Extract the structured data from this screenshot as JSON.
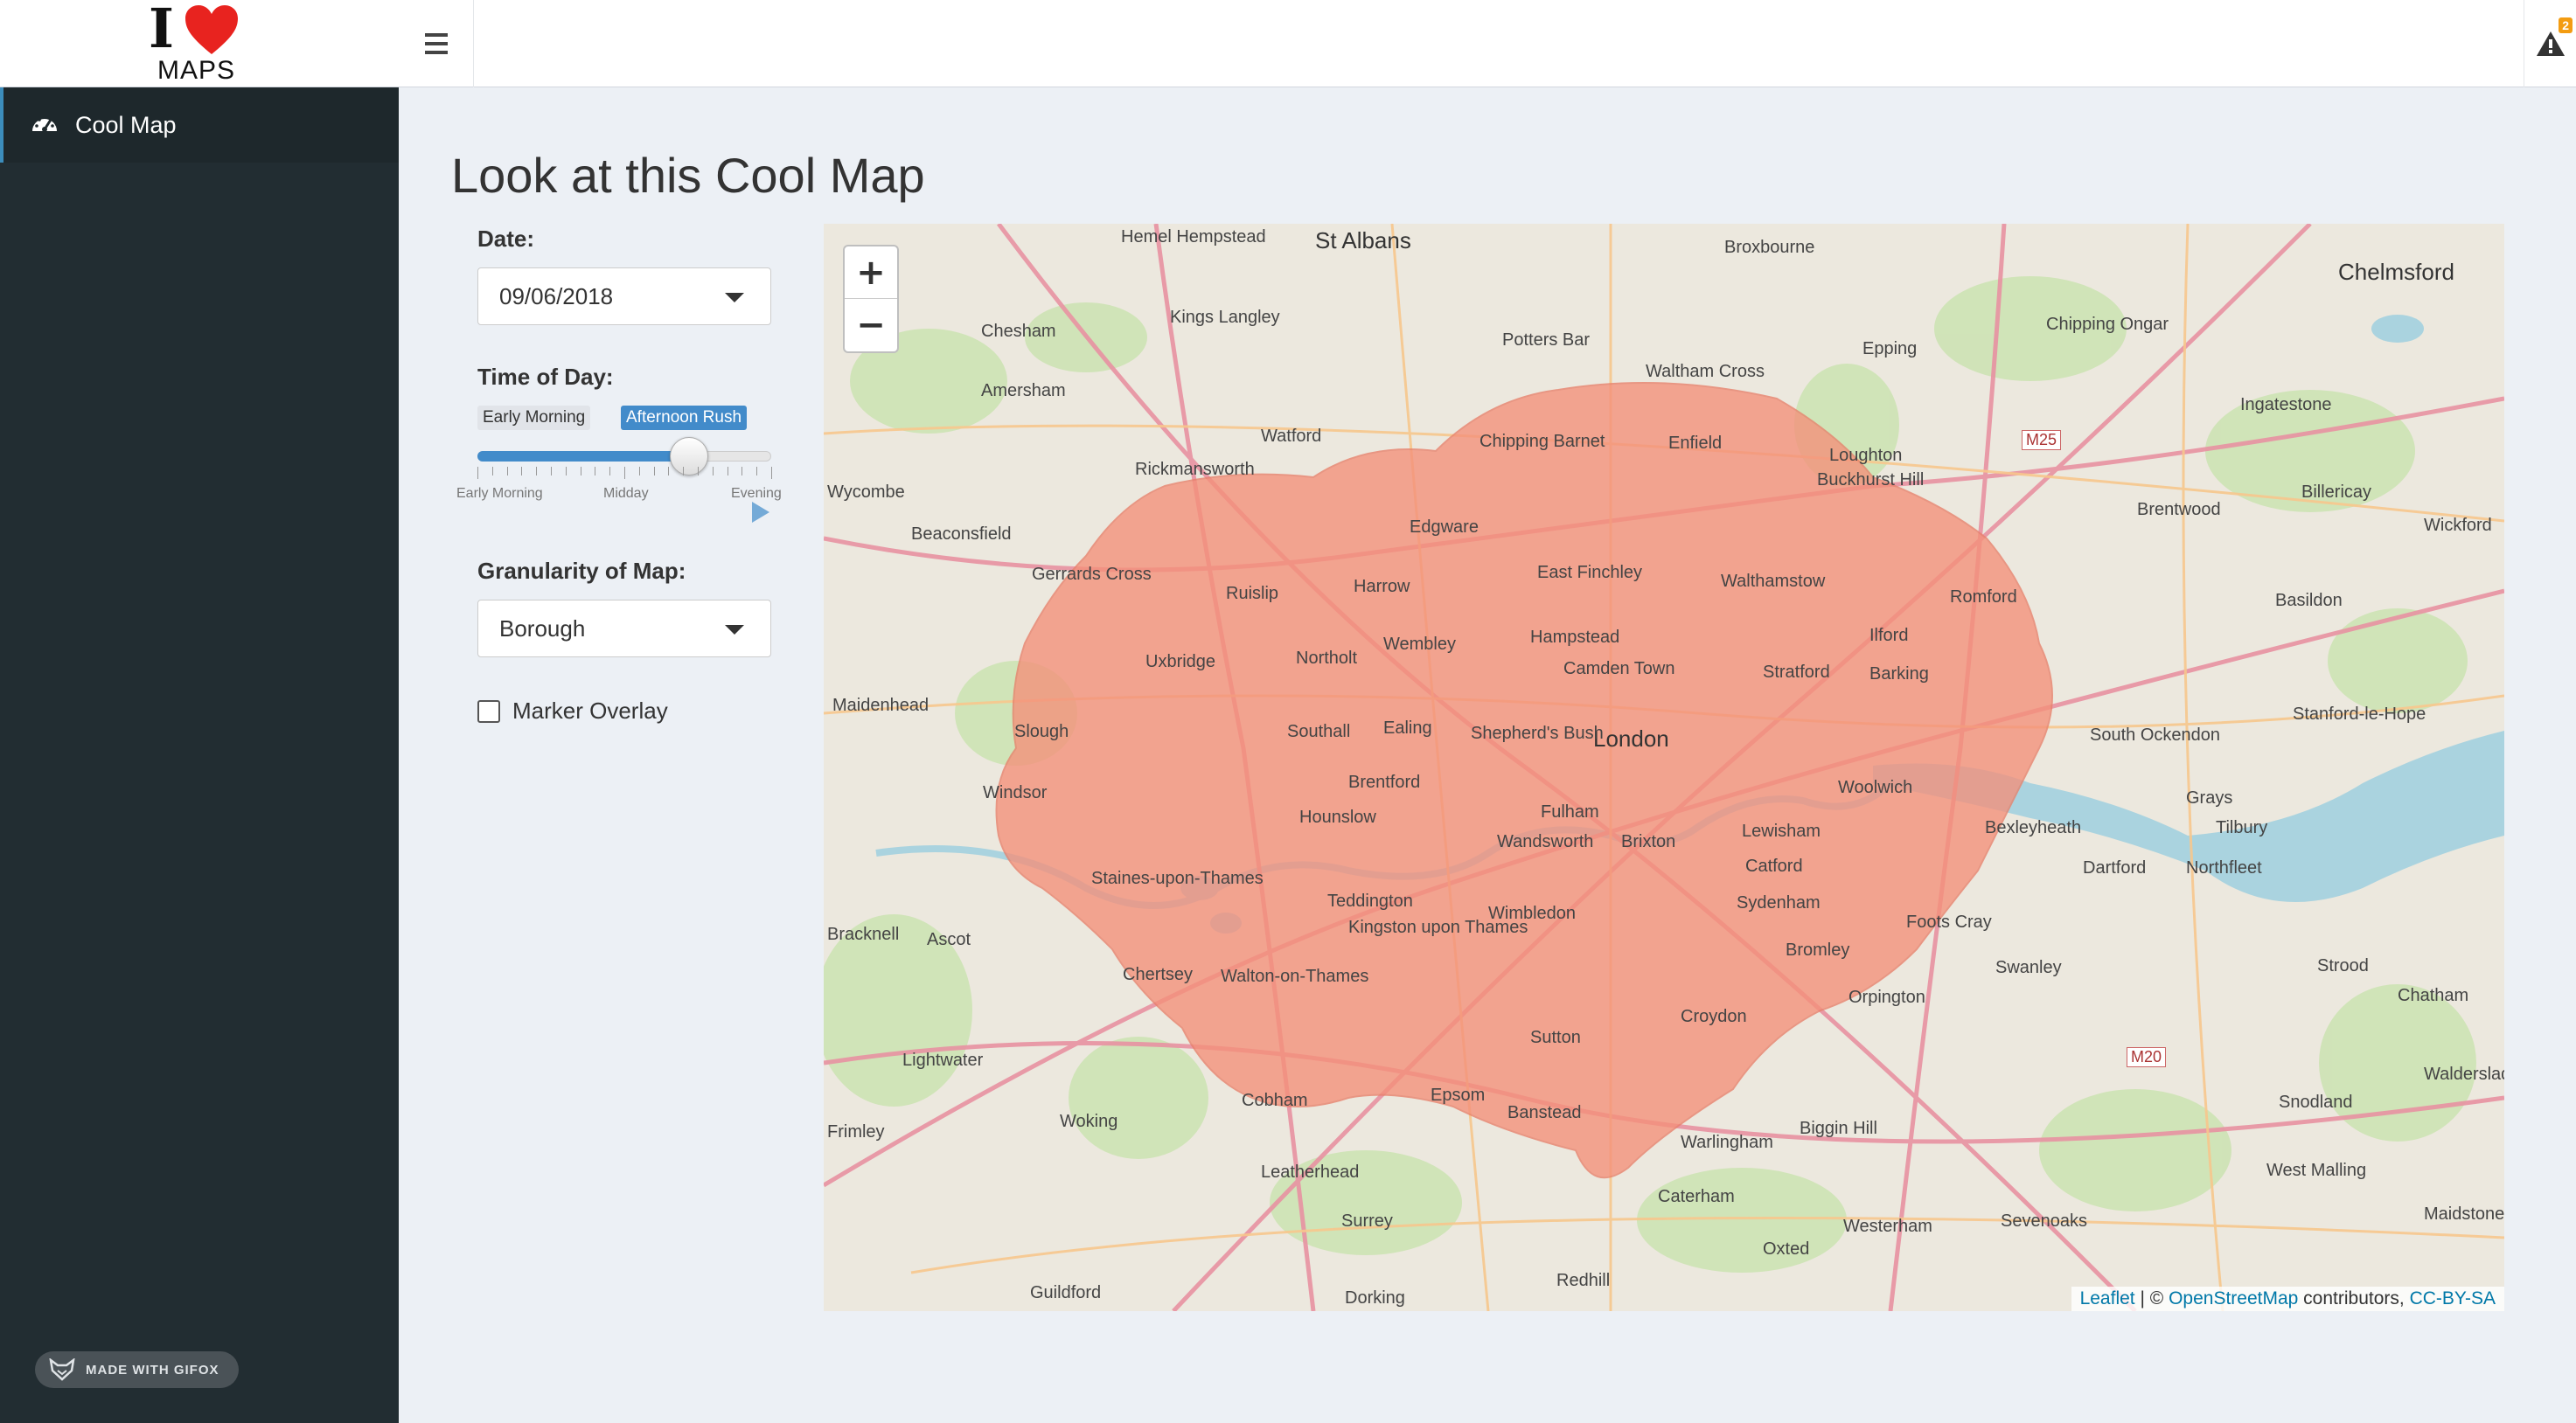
{
  "logo": {
    "letter": "I",
    "sub": "MAPS"
  },
  "header": {
    "notif_count": "2"
  },
  "sidebar": {
    "items": [
      {
        "label": "Cool Map",
        "icon": "dashboard-icon"
      }
    ],
    "footer": "MADE WITH GIFOX"
  },
  "main": {
    "title": "Look at this Cool Map",
    "date_label": "Date:",
    "date_value": "09/06/2018",
    "time_label": "Time of Day:",
    "time_from": "Early Morning",
    "time_to": "Afternoon Rush",
    "time_ticks": [
      "Early Morning",
      "Midday",
      "Evening"
    ],
    "time_position": 0.72,
    "gran_label": "Granularity of Map:",
    "gran_value": "Borough",
    "marker_label": "Marker Overlay",
    "marker_checked": false
  },
  "map": {
    "zoom_in": "+",
    "zoom_out": "−",
    "attribution": {
      "leaflet": "Leaflet",
      "sep": " | © ",
      "osm": "OpenStreetMap",
      "contrib": " contributors, ",
      "license": "CC-BY-SA"
    },
    "overlay_color": "#f4907a",
    "places_major": [
      "St Albans",
      "Chelmsford",
      "London"
    ],
    "places": [
      "Hemel Hempstead",
      "Broxbourne",
      "Kings Langley",
      "Chesham",
      "Potters Bar",
      "Chipping Ongar",
      "Epping",
      "Waltham Cross",
      "Amersham",
      "Ingatestone",
      "Watford",
      "Chipping Barnet",
      "Enfield",
      "Loughton",
      "Buckhurst Hill",
      "Rickmansworth",
      "Billericay",
      "Wycombe",
      "Brentwood",
      "Wickford",
      "Beaconsfield",
      "Edgware",
      "Gerrards Cross",
      "East Finchley",
      "Walthamstow",
      "Romford",
      "Ruislip",
      "Harrow",
      "Basildon",
      "Wembley",
      "Hampstead",
      "Ilford",
      "Uxbridge",
      "Northolt",
      "Camden Town",
      "Stratford",
      "Barking",
      "Maidenhead",
      "Stanford-le-Hope",
      "Slough",
      "Southall",
      "Ealing",
      "Shepherd's Bush",
      "South Ockendon",
      "Windsor",
      "Brentford",
      "Woolwich",
      "Grays",
      "Hounslow",
      "Fulham",
      "Tilbury",
      "Lewisham",
      "Bexleyheath",
      "Staines-upon-Thames",
      "Wandsworth",
      "Brixton",
      "Dartford",
      "Northfleet",
      "Catford",
      "Teddington",
      "Sydenham",
      "Kingston upon Thames",
      "Wimbledon",
      "Ascot",
      "Foots Cray",
      "Bromley",
      "Swanley",
      "Strood",
      "Chertsey",
      "Walton-on-Thames",
      "Orpington",
      "Croydon",
      "Sutton",
      "Lightwater",
      "Cobham",
      "Epsom",
      "Snodland",
      "Woking",
      "Banstead",
      "Biggin Hill",
      "Frimley",
      "Warlingham",
      "Leatherhead",
      "West Malling",
      "Caterham",
      "Sevenoaks",
      "Westerham",
      "Oxted",
      "Redhill",
      "Guildford",
      "Dorking",
      "Surrey",
      "Maidstone",
      "Chatham",
      "Walderslade",
      "Bracknell"
    ],
    "roads": [
      "M25",
      "M20"
    ]
  }
}
